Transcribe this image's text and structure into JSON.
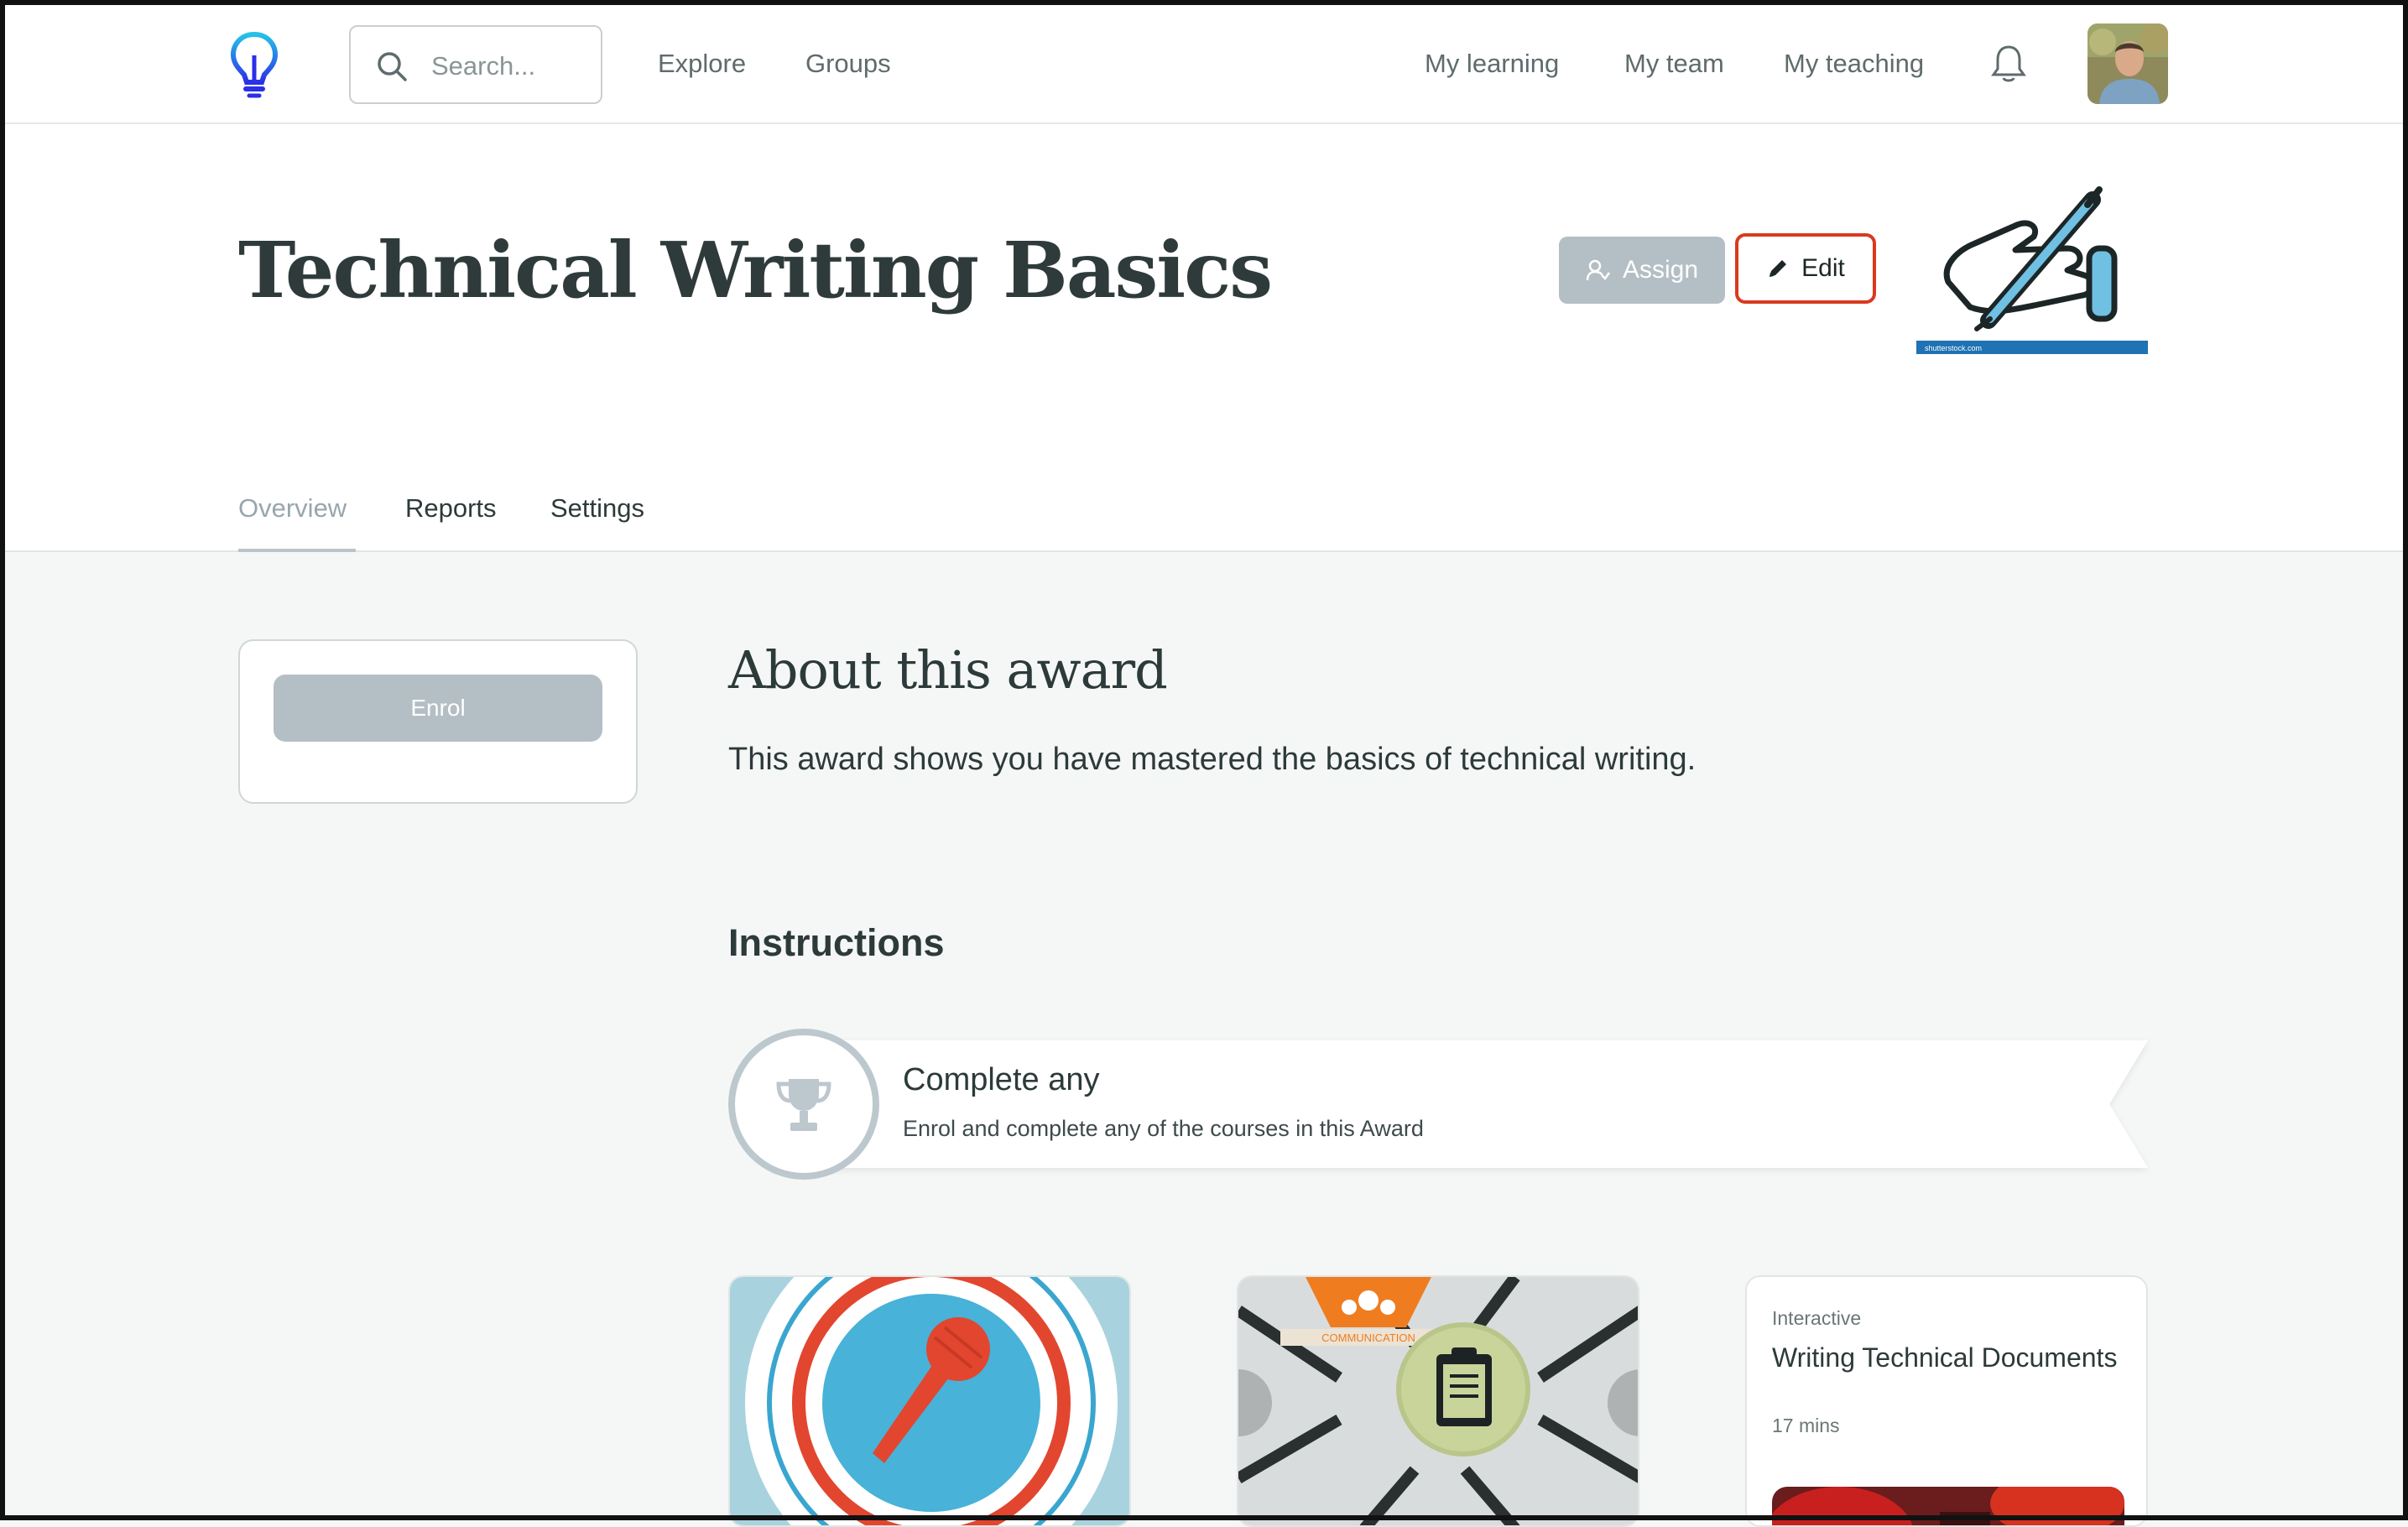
{
  "nav": {
    "search_placeholder": "Search...",
    "left_links": [
      "Explore",
      "Groups"
    ],
    "right_links": [
      "My learning",
      "My team",
      "My teaching"
    ]
  },
  "header": {
    "title": "Technical Writing Basics",
    "assign_label": "Assign",
    "edit_label": "Edit",
    "award_image_caption": "shutterstock.com"
  },
  "tabs": [
    {
      "label": "Overview",
      "active": true
    },
    {
      "label": "Reports",
      "active": false
    },
    {
      "label": "Settings",
      "active": false
    }
  ],
  "sidebar": {
    "enrol_label": "Enrol"
  },
  "about": {
    "title": "About this award",
    "description": "This award shows you have mastered the basics of technical writing."
  },
  "instructions": {
    "title": "Instructions",
    "step": {
      "title": "Complete any",
      "subtitle": "Enrol and complete any of the courses in this Award"
    }
  },
  "courses": [
    {
      "thumbnail": "microphone-icon"
    },
    {
      "thumbnail": "clipboard-icon",
      "badge": "COMMUNICATION"
    },
    {
      "type": "Interactive",
      "title": "Writing Technical Documents",
      "duration": "17 mins"
    }
  ],
  "colors": {
    "accent_blue": "#2a2fe8",
    "accent_cyan": "#26c2e8",
    "edit_border": "#d93a1f",
    "disabled_button": "#b4bfc5"
  }
}
